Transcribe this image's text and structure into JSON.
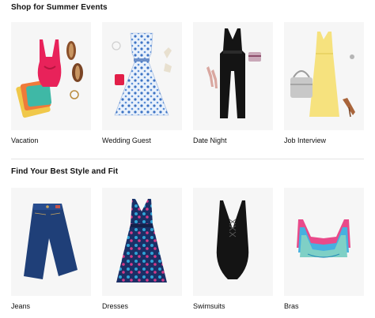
{
  "sections": [
    {
      "title": "Shop for Summer Events",
      "items": [
        {
          "label": "Vacation",
          "icon": "pink-swimsuit-beach-outfit-icon"
        },
        {
          "label": "Wedding Guest",
          "icon": "blue-floral-dress-icon"
        },
        {
          "label": "Date Night",
          "icon": "black-jumpsuit-icon"
        },
        {
          "label": "Job Interview",
          "icon": "yellow-sheath-dress-icon"
        }
      ]
    },
    {
      "title": "Find Your Best Style and Fit",
      "items": [
        {
          "label": "Jeans",
          "icon": "folded-jeans-icon"
        },
        {
          "label": "Dresses",
          "icon": "floral-print-dress-icon"
        },
        {
          "label": "Swimsuits",
          "icon": "black-lace-up-swimsuit-icon"
        },
        {
          "label": "Bras",
          "icon": "lace-bralettes-icon"
        }
      ]
    }
  ],
  "colors": {
    "background": "#ffffff",
    "tile": "#f6f6f6",
    "divider": "#e3e3e3",
    "text": "#111111"
  }
}
